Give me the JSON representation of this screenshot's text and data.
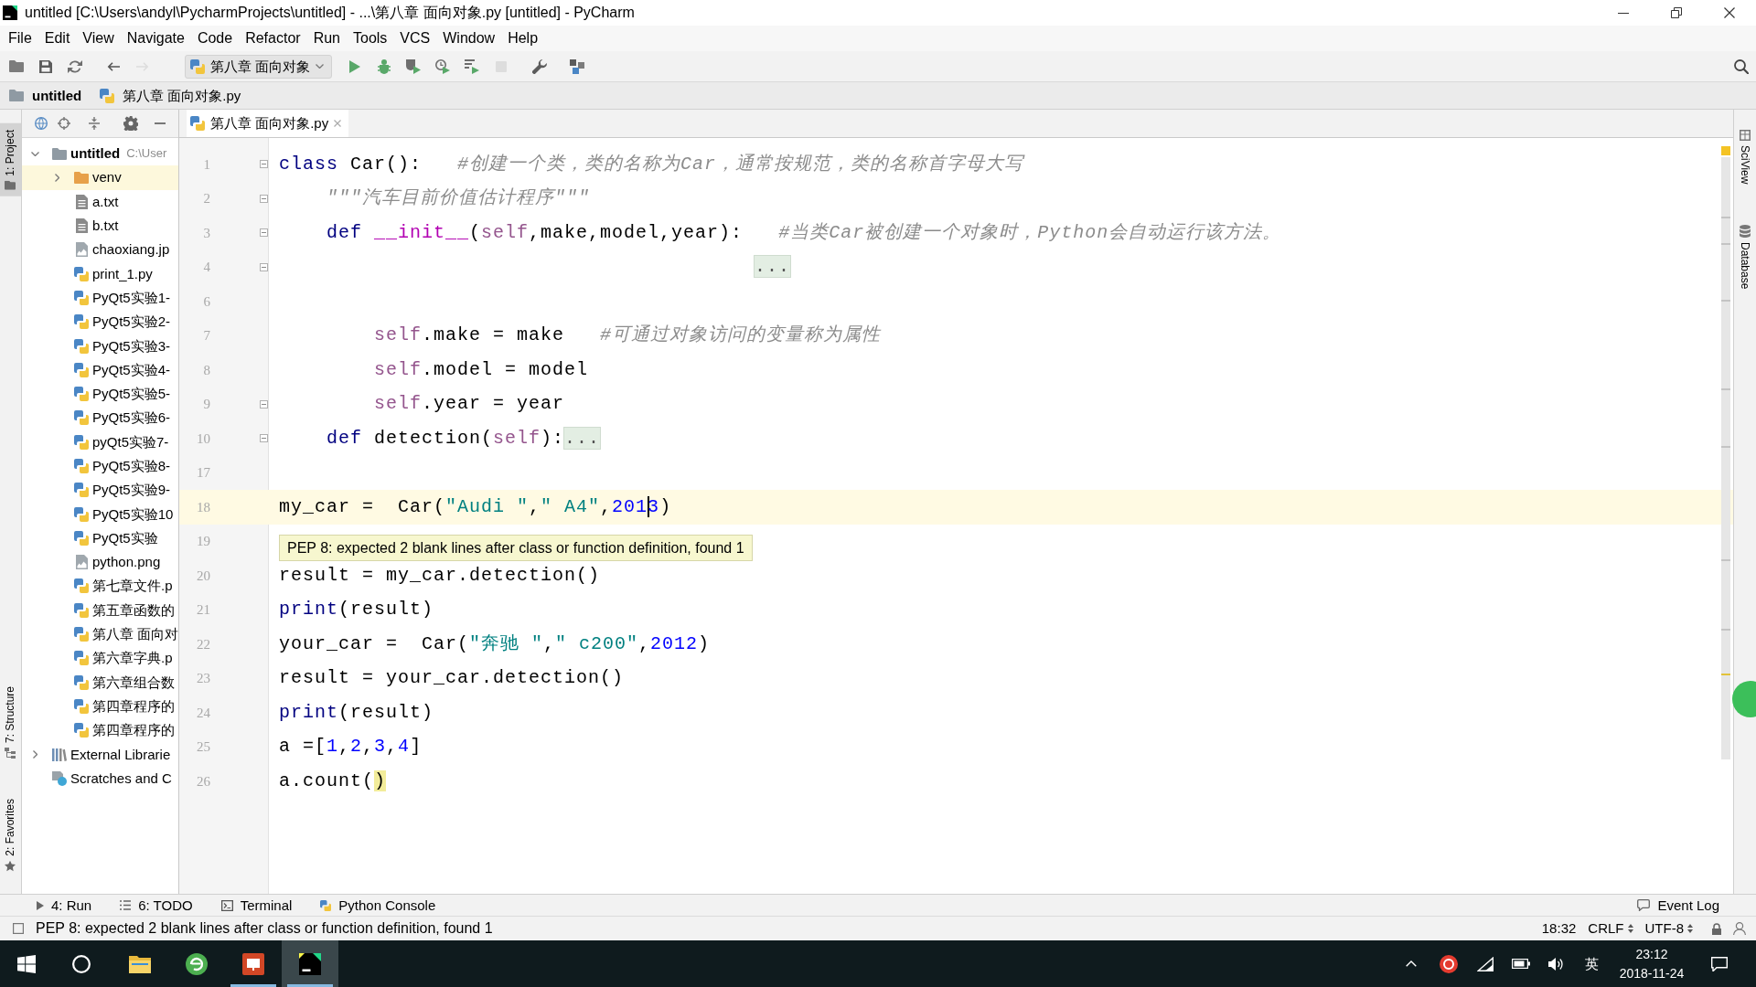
{
  "window": {
    "title": "untitled [C:\\Users\\andyl\\PycharmProjects\\untitled] - ...\\第八章 面向对象.py [untitled] - PyCharm"
  },
  "menu": [
    "File",
    "Edit",
    "View",
    "Navigate",
    "Code",
    "Refactor",
    "Run",
    "Tools",
    "VCS",
    "Window",
    "Help"
  ],
  "toolbar": {
    "file_buttons": [
      {
        "kind": "open",
        "disabled": false
      },
      {
        "kind": "save",
        "disabled": false
      },
      {
        "kind": "sync",
        "disabled": false
      }
    ],
    "history_buttons": [
      {
        "kind": "back",
        "disabled": false
      },
      {
        "kind": "forward",
        "disabled": true
      }
    ],
    "run_configuration": "第八章 面向对象",
    "run_buttons": [
      {
        "kind": "run",
        "disabled": false
      },
      {
        "kind": "debug",
        "disabled": false
      },
      {
        "kind": "coverage",
        "disabled": false
      },
      {
        "kind": "profile",
        "disabled": false
      },
      {
        "kind": "concurrency",
        "disabled": false
      },
      {
        "kind": "stop",
        "disabled": true
      }
    ],
    "tool_buttons": [
      {
        "kind": "settings",
        "disabled": false
      },
      {
        "kind": "structure",
        "disabled": false
      }
    ]
  },
  "navigation_bar": [
    {
      "kind": "folder",
      "label": "untitled"
    },
    {
      "kind": "python_file",
      "label": "第八章 面向对象.py"
    }
  ],
  "left_side_tabs": {
    "top": [
      {
        "kind": "project",
        "label": "1: Project",
        "selected": true
      }
    ],
    "bottom": [
      {
        "kind": "structure",
        "label": "7: Structure",
        "selected": false
      },
      {
        "kind": "favorites",
        "label": "2: Favorites",
        "selected": false
      }
    ]
  },
  "project_panel": {
    "tree": [
      {
        "kind": "project_folder",
        "label": "untitled",
        "path": "C:\\User",
        "expanded": true,
        "children": [
          {
            "kind": "excluded_folder",
            "label": "venv",
            "expanded": false
          },
          {
            "kind": "text_file",
            "label": "a.txt"
          },
          {
            "kind": "text_file",
            "label": "b.txt"
          },
          {
            "kind": "image_file",
            "label": "chaoxiang.jp"
          },
          {
            "kind": "python_file",
            "label": "print_1.py"
          },
          {
            "kind": "python_file",
            "label": "PyQt5实验1-"
          },
          {
            "kind": "python_file",
            "label": "PyQt5实验2-"
          },
          {
            "kind": "python_file",
            "label": "PyQt5实验3-"
          },
          {
            "kind": "python_file",
            "label": "PyQt5实验4-"
          },
          {
            "kind": "python_file",
            "label": "PyQt5实验5-"
          },
          {
            "kind": "python_file",
            "label": "PyQt5实验6-"
          },
          {
            "kind": "python_file",
            "label": "pyQt5实验7-"
          },
          {
            "kind": "python_file",
            "label": "PyQt5实验8-"
          },
          {
            "kind": "python_file",
            "label": "PyQt5实验9-"
          },
          {
            "kind": "python_file",
            "label": "PyQt5实验10"
          },
          {
            "kind": "python_file",
            "label": "PyQt5实验"
          },
          {
            "kind": "image_file",
            "label": "python.png"
          },
          {
            "kind": "python_file",
            "label": "第七章文件.p"
          },
          {
            "kind": "python_file",
            "label": "第五章函数的"
          },
          {
            "kind": "python_file",
            "label": "第八章 面向对"
          },
          {
            "kind": "python_file",
            "label": "第六章字典.p"
          },
          {
            "kind": "python_file",
            "label": "第六章组合数"
          },
          {
            "kind": "python_file",
            "label": "第四章程序的"
          },
          {
            "kind": "python_file",
            "label": "第四章程序的"
          }
        ]
      },
      {
        "kind": "library",
        "label": "External Librarie",
        "expanded": false
      },
      {
        "kind": "scratches",
        "label": "Scratches and C"
      }
    ]
  },
  "editor": {
    "tabs": [
      {
        "label": "第八章 面向对象.py",
        "selected": true
      }
    ],
    "lines": [
      {
        "number": "1",
        "current": false,
        "fold": true,
        "tokens": [
          {
            "kind": "keyword",
            "text": "class"
          },
          {
            "kind": "plain",
            "text": " Car():   "
          },
          {
            "kind": "comment",
            "text": "#创建一个类，类的名称为Car，通常按规范，类的名称首字母大写"
          }
        ]
      },
      {
        "number": "2",
        "current": false,
        "fold": true,
        "tokens": [
          {
            "kind": "docstring",
            "text": "    \"\"\"汽车目前价值估计程序\"\"\""
          }
        ]
      },
      {
        "number": "3",
        "current": false,
        "fold": true,
        "tokens": [
          {
            "kind": "keyword",
            "text": "    def "
          },
          {
            "kind": "magic",
            "text": "__init__"
          },
          {
            "kind": "plain",
            "text": "("
          },
          {
            "kind": "self",
            "text": "self"
          },
          {
            "kind": "plain",
            "text": ",make,model,year):   "
          },
          {
            "kind": "comment",
            "text": "#当类Car被创建一个对象时，Python会自动运行该方法。"
          }
        ]
      },
      {
        "number": "4",
        "current": false,
        "fold": true,
        "tokens": [
          {
            "kind": "folded",
            "text": "                                        ..."
          }
        ]
      },
      {
        "number": "6",
        "current": false,
        "fold": false
      },
      {
        "number": "7",
        "current": false,
        "fold": false,
        "tokens": [
          {
            "kind": "self",
            "text": "        self"
          },
          {
            "kind": "plain",
            "text": ".make = make   "
          },
          {
            "kind": "comment",
            "text": "#可通过对象访问的变量称为属性"
          }
        ]
      },
      {
        "number": "8",
        "current": false,
        "fold": false,
        "tokens": [
          {
            "kind": "self",
            "text": "        self"
          },
          {
            "kind": "plain",
            "text": ".model = model"
          }
        ]
      },
      {
        "number": "9",
        "current": false,
        "fold": true,
        "tokens": [
          {
            "kind": "self",
            "text": "        self"
          },
          {
            "kind": "plain",
            "text": ".year = year"
          }
        ]
      },
      {
        "number": "10",
        "current": false,
        "fold": true,
        "tokens": [
          {
            "kind": "keyword",
            "text": "    def"
          },
          {
            "kind": "plain",
            "text": " detection("
          },
          {
            "kind": "self",
            "text": "self"
          },
          {
            "kind": "plain",
            "text": "):"
          },
          {
            "kind": "folded",
            "text": "..."
          }
        ]
      },
      {
        "number": "17",
        "current": false,
        "fold": false
      },
      {
        "number": "18",
        "current": true,
        "fold": false,
        "tooltip": "PEP 8: expected 2 blank lines after class or function definition, found 1",
        "tokens": [
          {
            "kind": "plain",
            "text": "my_car =  Car("
          },
          {
            "kind": "string",
            "text": "\"Audi \""
          },
          {
            "kind": "plain",
            "text": ","
          },
          {
            "kind": "string",
            "text": "\" A4\""
          },
          {
            "kind": "plain",
            "text": ","
          },
          {
            "kind": "number",
            "text": "201"
          },
          {
            "kind": "caret"
          },
          {
            "kind": "number",
            "text": "3"
          },
          {
            "kind": "plain",
            "text": ")"
          }
        ]
      },
      {
        "number": "19",
        "current": false,
        "fold": false
      },
      {
        "number": "20",
        "current": false,
        "fold": false,
        "tokens": [
          {
            "kind": "plain",
            "text": "result = my_car.detection()"
          }
        ]
      },
      {
        "number": "21",
        "current": false,
        "fold": false,
        "tokens": [
          {
            "kind": "builtin",
            "text": "print"
          },
          {
            "kind": "plain",
            "text": "(result)"
          }
        ]
      },
      {
        "number": "22",
        "current": false,
        "fold": false,
        "tokens": [
          {
            "kind": "plain",
            "text": "your_car =  Car("
          },
          {
            "kind": "string",
            "text": "\"奔驰 \""
          },
          {
            "kind": "plain",
            "text": ","
          },
          {
            "kind": "string",
            "text": "\" c200\""
          },
          {
            "kind": "plain",
            "text": ","
          },
          {
            "kind": "number",
            "text": "2012"
          },
          {
            "kind": "plain",
            "text": ")"
          }
        ]
      },
      {
        "number": "23",
        "current": false,
        "fold": false,
        "tokens": [
          {
            "kind": "plain",
            "text": "result = your_car.detection()"
          }
        ]
      },
      {
        "number": "24",
        "current": false,
        "fold": false,
        "tokens": [
          {
            "kind": "builtin",
            "text": "print"
          },
          {
            "kind": "plain",
            "text": "(result)"
          }
        ]
      },
      {
        "number": "25",
        "current": false,
        "fold": false,
        "tokens": [
          {
            "kind": "plain",
            "text": "a =["
          },
          {
            "kind": "number",
            "text": "1"
          },
          {
            "kind": "plain",
            "text": ","
          },
          {
            "kind": "number",
            "text": "2"
          },
          {
            "kind": "plain",
            "text": ","
          },
          {
            "kind": "number",
            "text": "3"
          },
          {
            "kind": "plain",
            "text": ","
          },
          {
            "kind": "number",
            "text": "4"
          },
          {
            "kind": "plain",
            "text": "]"
          }
        ]
      },
      {
        "number": "26",
        "current": false,
        "fold": false,
        "tokens": [
          {
            "kind": "plain",
            "text": "a.count("
          },
          {
            "kind": "brace_match",
            "text": ")"
          }
        ]
      }
    ]
  },
  "right_side_tabs": [
    {
      "kind": "sciview",
      "label": "SciView",
      "selected": false
    },
    {
      "kind": "database",
      "label": "Database",
      "selected": false
    }
  ],
  "tool_windows": [
    {
      "kind": "run",
      "label": "4: Run"
    },
    {
      "kind": "todo",
      "label": "6: TODO"
    },
    {
      "kind": "terminal",
      "label": "Terminal"
    },
    {
      "kind": "console",
      "label": "Python Console"
    }
  ],
  "event_log": "Event Log",
  "status_bar": {
    "message": "PEP 8: expected 2 blank lines after class or function definition, found 1",
    "caret_position": "18:32",
    "line_separator": "CRLF",
    "encoding": "UTF-8"
  },
  "taskbar": {
    "apps": [
      {
        "kind": "explorer",
        "running": false,
        "active": false
      },
      {
        "kind": "browser",
        "running": false,
        "active": false
      },
      {
        "kind": "presentation",
        "running": true,
        "active": false
      },
      {
        "kind": "pycharm",
        "running": true,
        "active": true
      }
    ],
    "input_method": "英",
    "time": "23:12",
    "date": "2018-11-24"
  }
}
